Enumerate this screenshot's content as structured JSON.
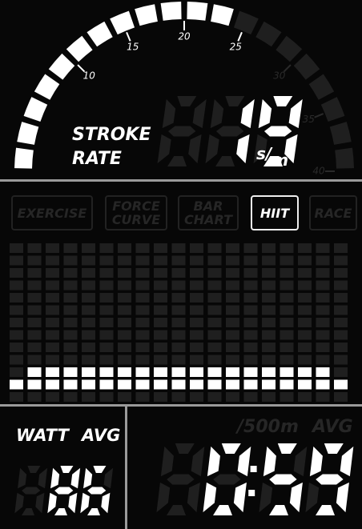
{
  "stroke_rate": {
    "label_line1": "STROKE",
    "label_line2": "RATE",
    "value": "19",
    "unit_s": "s",
    "unit_sep": "/",
    "unit_m": "m",
    "gauge_ticks": [
      "10",
      "15",
      "20",
      "25",
      "30",
      "35",
      "40"
    ],
    "gauge_max": 40,
    "gauge_filled_segments": 12,
    "gauge_total_segments": 20
  },
  "tabs": [
    {
      "line1": "EXERCISE",
      "line2": "",
      "active": false
    },
    {
      "line1": "FORCE",
      "line2": "CURVE",
      "active": false
    },
    {
      "line1": "BAR",
      "line2": "CHART",
      "active": false
    },
    {
      "line1": "HIIT",
      "line2": "",
      "active": true
    },
    {
      "line1": "RACE",
      "line2": "",
      "active": false
    }
  ],
  "bar_chart": {
    "columns": 19,
    "rows": 13,
    "lit_heights": [
      1,
      2,
      2,
      2,
      2,
      2,
      2,
      2,
      2,
      2,
      2,
      2,
      2,
      2,
      2,
      2,
      2,
      2,
      1
    ]
  },
  "watt": {
    "label": "WATT",
    "avg_label": "AVG",
    "value": "86"
  },
  "pace": {
    "unit_label": "/500m",
    "avg_label": "AVG",
    "value": "0:59"
  },
  "colors": {
    "lit": "#ffffff",
    "unlit": "#1f1f1f",
    "divider": "#9a9a9a"
  }
}
